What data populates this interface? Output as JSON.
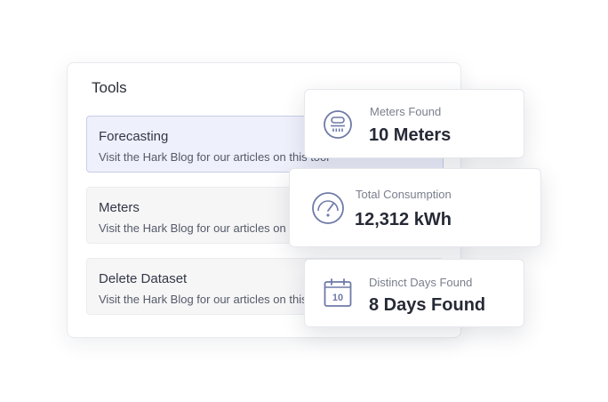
{
  "tools": {
    "title": "Tools",
    "items": [
      {
        "name": "Forecasting",
        "description": "Visit the Hark Blog for our articles on this tool"
      },
      {
        "name": "Meters",
        "description": "Visit the Hark Blog for our articles on this tool"
      },
      {
        "name": "Delete Dataset",
        "description": "Visit the Hark Blog for our articles on this tool"
      }
    ]
  },
  "stats": {
    "meters": {
      "label": "Meters Found",
      "value": "10 Meters",
      "icon": "meter-icon"
    },
    "consumption": {
      "label": "Total Consumption",
      "value": "12,312 kWh",
      "icon": "gauge-icon"
    },
    "days": {
      "label": "Distinct Days Found",
      "value": "8 Days Found",
      "icon": "calendar-icon",
      "icon_text": "10"
    }
  },
  "colors": {
    "icon": "#6e7aa8",
    "active_item_bg": "#eef0fb",
    "active_item_border": "#c9cde9"
  }
}
